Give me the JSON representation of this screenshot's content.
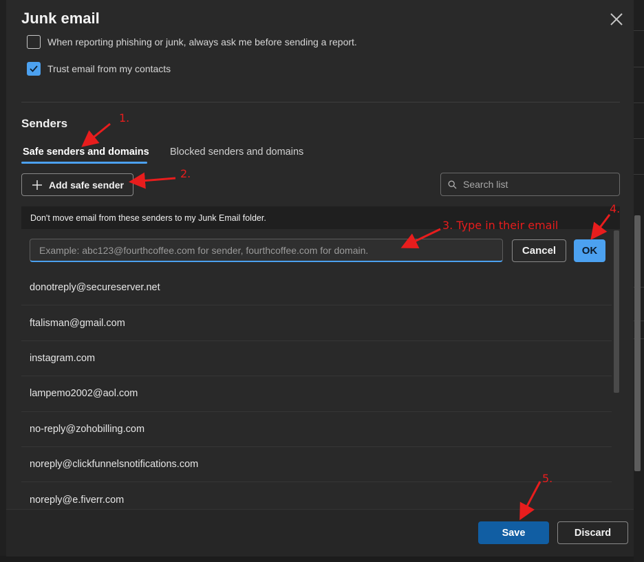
{
  "dialog": {
    "title": "Junk email",
    "options": {
      "phishing_prompt_label": "When reporting phishing or junk, always ask me before sending a report.",
      "phishing_prompt_checked": false,
      "trust_contacts_label": "Trust email from my contacts",
      "trust_contacts_checked": true
    }
  },
  "senders": {
    "section_title": "Senders",
    "tabs": [
      {
        "label": "Safe senders and domains",
        "active": true
      },
      {
        "label": "Blocked senders and domains",
        "active": false
      }
    ],
    "add_button_label": "Add safe sender",
    "search_placeholder": "Search list",
    "banner_text": "Don't move email from these senders to my Junk Email folder.",
    "input_placeholder": "Example: abc123@fourthcoffee.com for sender, fourthcoffee.com for domain.",
    "cancel_label": "Cancel",
    "ok_label": "OK",
    "list": [
      "donotreply@secureserver.net",
      "ftalisman@gmail.com",
      "instagram.com",
      "lampemo2002@aol.com",
      "no-reply@zohobilling.com",
      "noreply@clickfunnelsnotifications.com",
      "noreply@e.fiverr.com"
    ]
  },
  "footer": {
    "save_label": "Save",
    "discard_label": "Discard"
  },
  "annotations": {
    "step1": "1.",
    "step2": "2.",
    "step3": "3. Type in their email",
    "step4": "4.",
    "step5": "5."
  },
  "colors": {
    "accent": "#4ca1f0",
    "primary_button": "#115ea3",
    "annotation": "#e81d1d",
    "background": "#292929"
  }
}
